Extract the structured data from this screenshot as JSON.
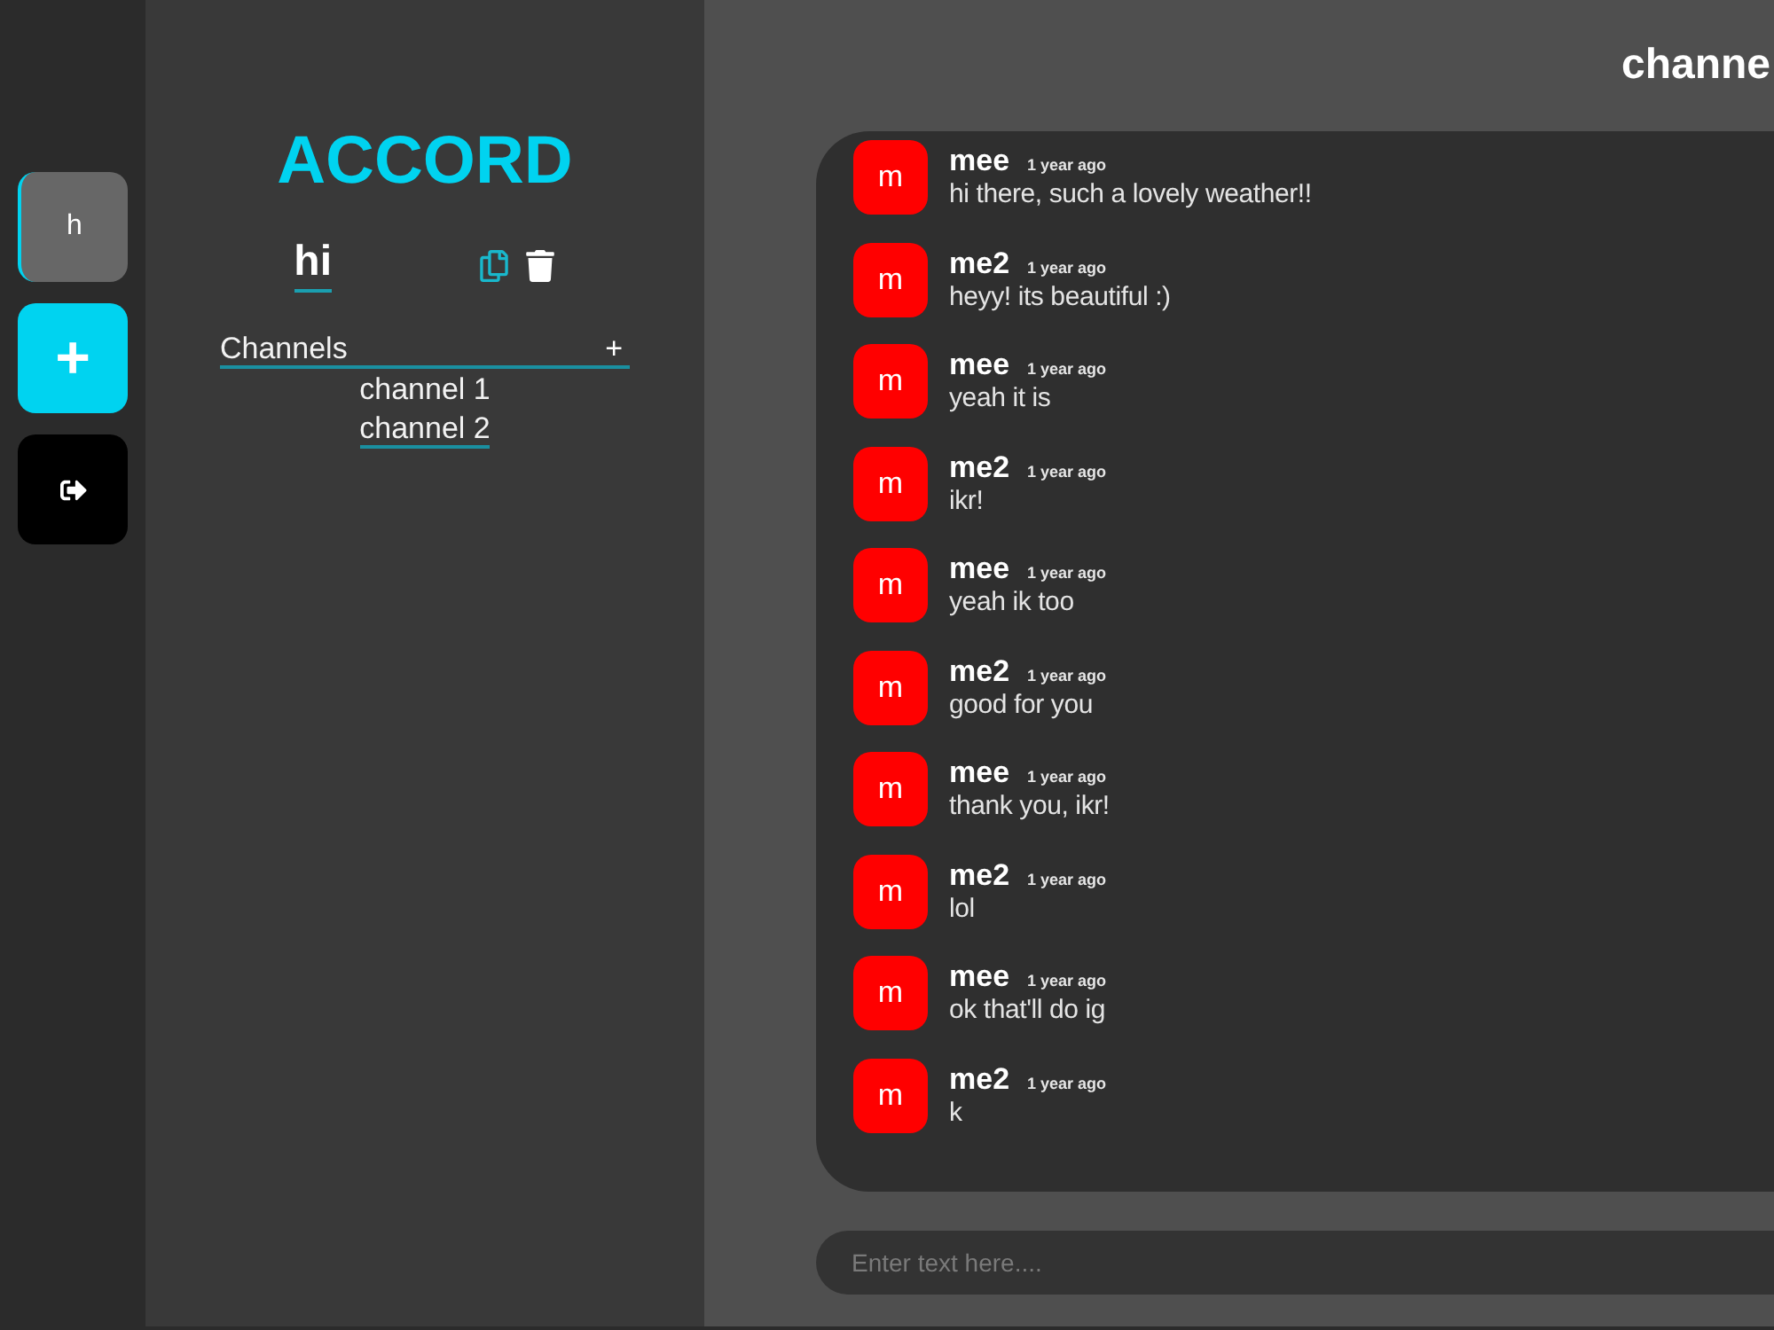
{
  "servers": [
    {
      "label": "h",
      "selected": true
    }
  ],
  "rail_actions": [
    {
      "kind": "add",
      "label": "+"
    },
    {
      "kind": "logout"
    }
  ],
  "app_title": "ACCORD",
  "server": {
    "name": "hi"
  },
  "channels": {
    "heading": "Channels",
    "add": "+",
    "items": [
      {
        "name": "channel 1",
        "selected": false
      },
      {
        "name": "channel 2",
        "selected": true
      }
    ]
  },
  "header": {
    "title": "channe"
  },
  "messages": [
    {
      "avatar": "m",
      "author": "mee",
      "time": "1 year ago",
      "text": "hi there, such a lovely weather!!"
    },
    {
      "avatar": "m",
      "author": "me2",
      "time": "1 year ago",
      "text": "heyy! its beautiful :)"
    },
    {
      "avatar": "m",
      "author": "mee",
      "time": "1 year ago",
      "text": "yeah it is"
    },
    {
      "avatar": "m",
      "author": "me2",
      "time": "1 year ago",
      "text": "ikr!"
    },
    {
      "avatar": "m",
      "author": "mee",
      "time": "1 year ago",
      "text": "yeah ik too"
    },
    {
      "avatar": "m",
      "author": "me2",
      "time": "1 year ago",
      "text": "good for you"
    },
    {
      "avatar": "m",
      "author": "mee",
      "time": "1 year ago",
      "text": "thank you, ikr!"
    },
    {
      "avatar": "m",
      "author": "me2",
      "time": "1 year ago",
      "text": "lol"
    },
    {
      "avatar": "m",
      "author": "mee",
      "time": "1 year ago",
      "text": "ok that'll do ig"
    },
    {
      "avatar": "m",
      "author": "me2",
      "time": "1 year ago",
      "text": "k"
    }
  ],
  "composer": {
    "placeholder": "Enter text here...."
  }
}
